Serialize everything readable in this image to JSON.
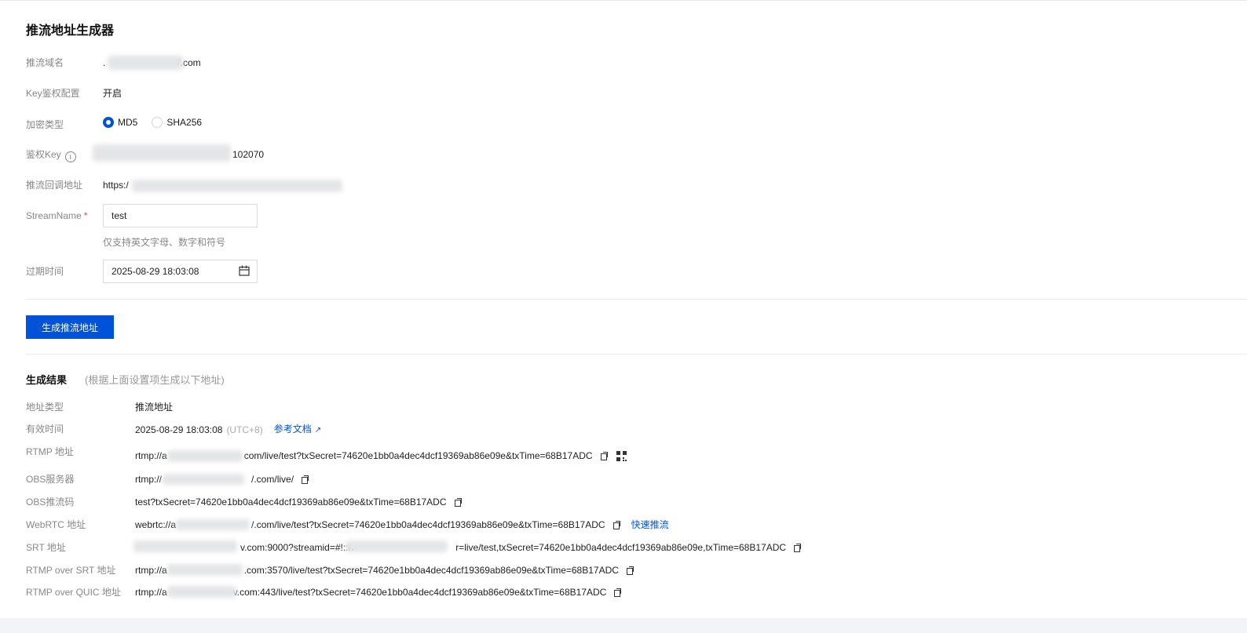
{
  "page": {
    "title": "推流地址生成器"
  },
  "form": {
    "domain": {
      "label": "推流域名",
      "value_prefix": ".",
      "value_suffix": "/.com"
    },
    "key_auth": {
      "label": "Key鉴权配置",
      "value": "开启"
    },
    "encrypt": {
      "label": "加密类型",
      "options": [
        "MD5",
        "SHA256"
      ],
      "selected": "MD5"
    },
    "auth_key": {
      "label": "鉴权Key",
      "info_icon": "i",
      "value_suffix": "102070"
    },
    "callback": {
      "label": "推流回调地址",
      "value_prefix": "https:/"
    },
    "stream_name": {
      "label": "StreamName",
      "required_mark": "*",
      "value": "test",
      "hint": "仅支持英文字母、数字和符号"
    },
    "expire": {
      "label": "过期时间",
      "value": "2025-08-29 18:03:08"
    },
    "submit_label": "生成推流地址"
  },
  "result": {
    "title": "生成结果",
    "subtitle": "(根据上面设置项生成以下地址)",
    "rows": {
      "addr_type": {
        "label": "地址类型",
        "value": "推流地址"
      },
      "valid_time": {
        "label": "有效时间",
        "value": "2025-08-29 18:03:08",
        "tz": "(UTC+8)",
        "doc_link": "参考文档"
      },
      "rtmp": {
        "label": "RTMP 地址",
        "pre": "rtmp://a",
        "post": "com/live/test?txSecret=74620e1bb0a4dec4dcf19369ab86e09e&txTime=68B17ADC"
      },
      "obs_server": {
        "label": "OBS服务器",
        "pre": "rtmp://",
        "post": "/.com/live/"
      },
      "obs_key": {
        "label": "OBS推流码",
        "value": "test?txSecret=74620e1bb0a4dec4dcf19369ab86e09e&txTime=68B17ADC"
      },
      "webrtc": {
        "label": "WebRTC 地址",
        "pre": "webrtc://a",
        "post": "/.com/live/test?txSecret=74620e1bb0a4dec4dcf19369ab86e09e&txTime=68B17ADC",
        "quick_link": "快速推流"
      },
      "srt": {
        "label": "SRT 地址",
        "mid": "v.com:9000?streamid=#!::h",
        "post": "r=live/test,txSecret=74620e1bb0a4dec4dcf19369ab86e09e,txTime=68B17ADC"
      },
      "rtmp_srt": {
        "label": "RTMP over SRT 地址",
        "pre": "rtmp://a",
        "post": ".com:3570/live/test?txSecret=74620e1bb0a4dec4dcf19369ab86e09e&txTime=68B17ADC"
      },
      "rtmp_quic": {
        "label": "RTMP over QUIC 地址",
        "pre": "rtmp://a",
        "post": "v.com:443/live/test?txSecret=74620e1bb0a4dec4dcf19369ab86e09e&txTime=68B17ADC"
      }
    }
  },
  "colors": {
    "primary": "#0052d9",
    "label": "#888888",
    "required": "#e54545"
  }
}
